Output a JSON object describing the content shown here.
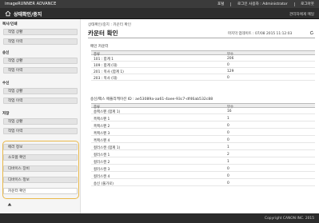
{
  "header": {
    "brand": "imageRUNNER ADVANCE",
    "links": [
      "포털",
      "로그인 사용자 : Administrator",
      "로그아웃"
    ],
    "title": "상태확인/중지",
    "mail_link": "관리자에게 메일"
  },
  "sidebar": {
    "sections": [
      {
        "title": "복사/인쇄",
        "items": [
          "작업 상황",
          "작업 이력"
        ]
      },
      {
        "title": "송신",
        "items": [
          "작업 상황",
          "작업 이력"
        ]
      },
      {
        "title": "수신",
        "items": [
          "작업 상황",
          "작업 이력"
        ]
      },
      {
        "title": "저장",
        "items": [
          "작업 상황",
          "작업 이력"
        ]
      }
    ],
    "extra_items": [
      "에러 정보",
      "소모품 확인",
      "디바이스 장비",
      "디바이스 정보",
      "카운터 확인"
    ],
    "active_item": "카운터 확인"
  },
  "main": {
    "breadcrumb": "상태확인/중지 : 카운터 확인",
    "title": "카운터 확인",
    "updated": "마지막 업데이트 : 07/08 2015 11:12:03",
    "section1_label": "메인 카운터",
    "col_type": "종류",
    "col_count": "부수",
    "section1_rows": [
      {
        "name": "101 : 합계 1",
        "value": "206"
      },
      {
        "name": "109 : 합계 (대)",
        "value": "0"
      },
      {
        "name": "201 : 복사 (합계 1)",
        "value": "129"
      },
      {
        "name": "203 : 복사 (대)",
        "value": "0"
      }
    ],
    "section2_label": "송신/팩스 애플리케이션 ID : ae53089a-aa61-4aee-93c7-df46ab532c88",
    "section2_rows": [
      {
        "name": "송팩스펜 (합계 1)",
        "value": "16"
      },
      {
        "name": "흑팩스펜 1",
        "value": "1"
      },
      {
        "name": "흑팩스펜 2",
        "value": "0"
      },
      {
        "name": "흑팩스펜 3",
        "value": "0"
      },
      {
        "name": "흑팩스펜 4",
        "value": "0"
      },
      {
        "name": "컬러스캔 (합계 1)",
        "value": "1"
      },
      {
        "name": "컬러스캔 1",
        "value": "2"
      },
      {
        "name": "컬러스캔 2",
        "value": "1"
      },
      {
        "name": "컬러스캔 3",
        "value": "0"
      },
      {
        "name": "컬러스캔 4",
        "value": "0"
      },
      {
        "name": "송신 (풀가로)",
        "value": "0"
      }
    ]
  },
  "footer": {
    "copyright": "Copyright CANON INC. 2015"
  }
}
